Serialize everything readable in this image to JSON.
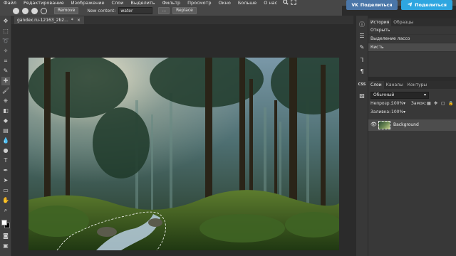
{
  "menubar": {
    "items": [
      "Файл",
      "Редактирование",
      "Изображение",
      "Слои",
      "Выделить",
      "Фильтр",
      "Просмотр",
      "Окно",
      "Больше",
      "О нас"
    ],
    "share_vk": "Поделиться",
    "share_tg": "Поделиться"
  },
  "options": {
    "remove_label": "Remove",
    "new_content_label": "New content:",
    "new_content_value": "water",
    "more_label": "...",
    "replace_label": "Replace"
  },
  "document": {
    "tab_title": "gandex.ru-12163_2b2...",
    "tab_modified": "*",
    "tab_close": "×"
  },
  "history": {
    "tabs": [
      "История",
      "Образцы"
    ],
    "items": [
      "Открыть",
      "Выделение лассо",
      "Кисть"
    ]
  },
  "layers": {
    "tabs": [
      "Слои",
      "Каналы",
      "Контуры"
    ],
    "blend_mode": "Обычный",
    "opacity_label": "Непрозр.:",
    "opacity_value": "100%",
    "lock_label": "Замок:",
    "fill_label": "Заливка:",
    "fill_value": "100%",
    "layer_name": "Background"
  },
  "panel_icons": {
    "css_label": "CSS"
  },
  "colors": {
    "vk": "#4a76a8",
    "telegram": "#2ea6e0",
    "panel_bg": "#383838",
    "workspace_bg": "#2b2b2b"
  }
}
